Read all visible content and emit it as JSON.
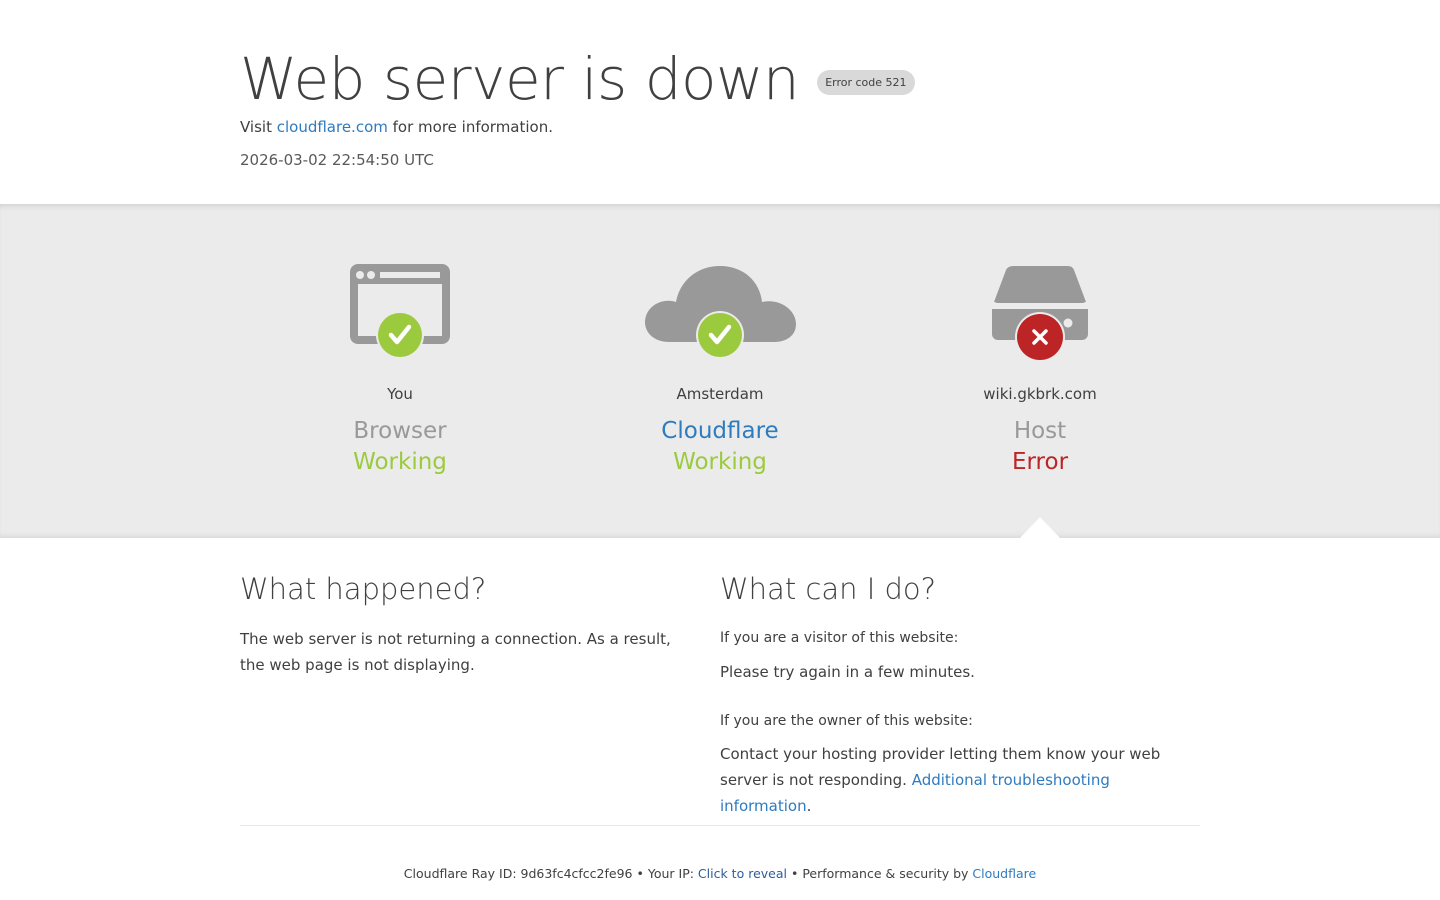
{
  "header": {
    "title": "Web server is down",
    "badge": "Error code 521",
    "visit_prefix": "Visit ",
    "visit_link": "cloudflare.com",
    "visit_suffix": " for more information.",
    "timestamp": "2026-03-02 22:54:50 UTC"
  },
  "status": [
    {
      "location": "You",
      "role": "Browser",
      "state": "Working",
      "icon": "browser-icon",
      "status_icon": "checkmark-icon"
    },
    {
      "location": "Amsterdam",
      "role": "Cloudflare",
      "state": "Working",
      "icon": "cloud-icon",
      "status_icon": "checkmark-icon"
    },
    {
      "location": "wiki.gkbrk.com",
      "role": "Host",
      "state": "Error",
      "icon": "server-icon",
      "status_icon": "error-x-icon"
    }
  ],
  "colors": {
    "ok": "#9bca3e",
    "error": "#bd2426",
    "link": "#2f7bbf",
    "icon_gray": "#999999"
  },
  "what_happened": {
    "heading": "What happened?",
    "text": "The web server is not returning a connection. As a result, the web page is not displaying."
  },
  "what_can_i_do": {
    "heading": "What can I do?",
    "visitor_label": "If you are a visitor of this website:",
    "visitor_text": "Please try again in a few minutes.",
    "owner_label": "If you are the owner of this website:",
    "owner_text": "Contact your hosting provider letting them know your web server is not responding.",
    "owner_link": "Additional troubleshooting information",
    "owner_suffix": "."
  },
  "footer": {
    "ray_label": "Cloudflare Ray ID: ",
    "ray_id": "9d63fc4cfcc2fe96",
    "sep1": " • ",
    "ip_label": "Your IP: ",
    "ip_reveal": "Click to reveal",
    "sep2": " • ",
    "perf_label": "Performance & security by ",
    "perf_link": "Cloudflare"
  }
}
